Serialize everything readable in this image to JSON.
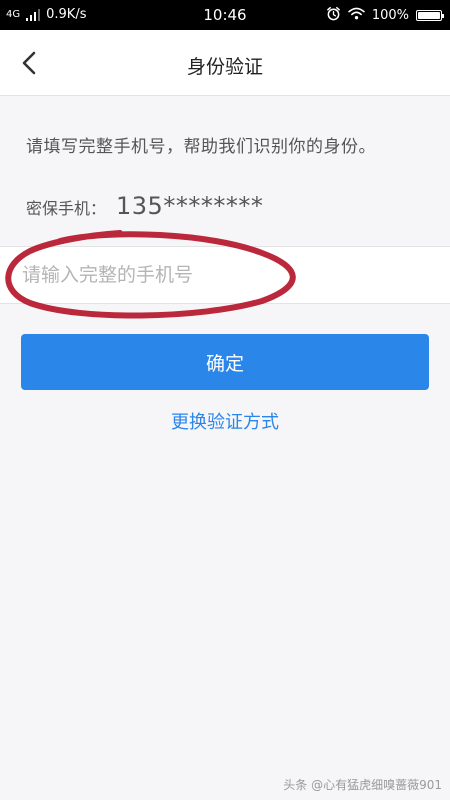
{
  "status_bar": {
    "network_type": "4G",
    "signal_icon": "signal-bars-icon",
    "speed": "0.9K/s",
    "time": "10:46",
    "alarm_icon": "alarm-clock-icon",
    "wifi_icon": "wifi-icon",
    "battery_percent": "100%",
    "battery_level": 1.0
  },
  "nav": {
    "back_icon": "chevron-left-icon",
    "title": "身份验证"
  },
  "content": {
    "hint": "请填写完整手机号，帮助我们识别你的身份。",
    "phone_label": "密保手机：",
    "phone_value": "135********"
  },
  "phone_input": {
    "placeholder": "请输入完整的手机号",
    "value": ""
  },
  "actions": {
    "confirm_label": "确定",
    "switch_method_label": "更换验证方式"
  },
  "annotation": {
    "shape": "hand-drawn ellipse",
    "color": "#b5162a"
  },
  "watermark": "头条 @心有猛虎细嗅蔷薇901",
  "colors": {
    "accent": "#2b86e9",
    "background": "#f6f6f8"
  }
}
